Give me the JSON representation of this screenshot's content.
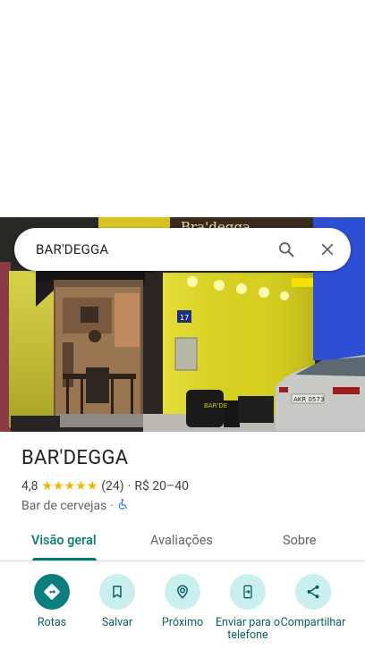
{
  "search": {
    "query": "BAR'DEGGA"
  },
  "photo": {
    "storefront_number": "17",
    "awning_sign": "BAR'DEGGA",
    "cooler_text": "BAR'DE",
    "wall_sign": "Bra'degga",
    "plate": "AKR 0573"
  },
  "place": {
    "name": "BAR'DEGGA",
    "rating": "4,8",
    "stars": "★★★★★",
    "reviews": "(24)",
    "separator": "·",
    "price": "R$ 20–40",
    "category": "Bar de cervejas",
    "category_sep": "·"
  },
  "tabs": [
    {
      "label": "Visão geral"
    },
    {
      "label": "Avaliações"
    },
    {
      "label": "Sobre"
    }
  ],
  "actions": [
    {
      "label": "Rotas",
      "icon": "directions-icon"
    },
    {
      "label": "Salvar",
      "icon": "bookmark-icon"
    },
    {
      "label": "Próximo",
      "icon": "nearby-icon"
    },
    {
      "label": "Enviar para o telefone",
      "icon": "send-to-phone-icon"
    },
    {
      "label": "Compartilhar",
      "icon": "share-icon"
    }
  ],
  "colors": {
    "accent": "#00796b",
    "primary_button": "#0b7f80",
    "chip_bg": "#c9efef",
    "star": "#f4b400"
  }
}
